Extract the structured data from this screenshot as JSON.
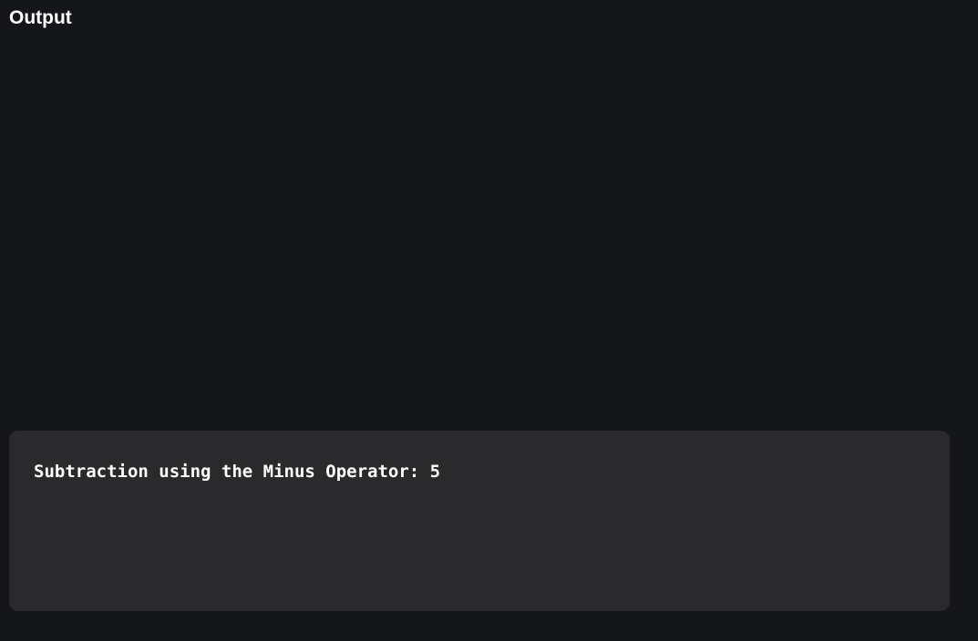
{
  "header": {
    "title": "Output"
  },
  "output": {
    "lines": [
      "Subtraction using the Minus Operator: 5"
    ]
  }
}
